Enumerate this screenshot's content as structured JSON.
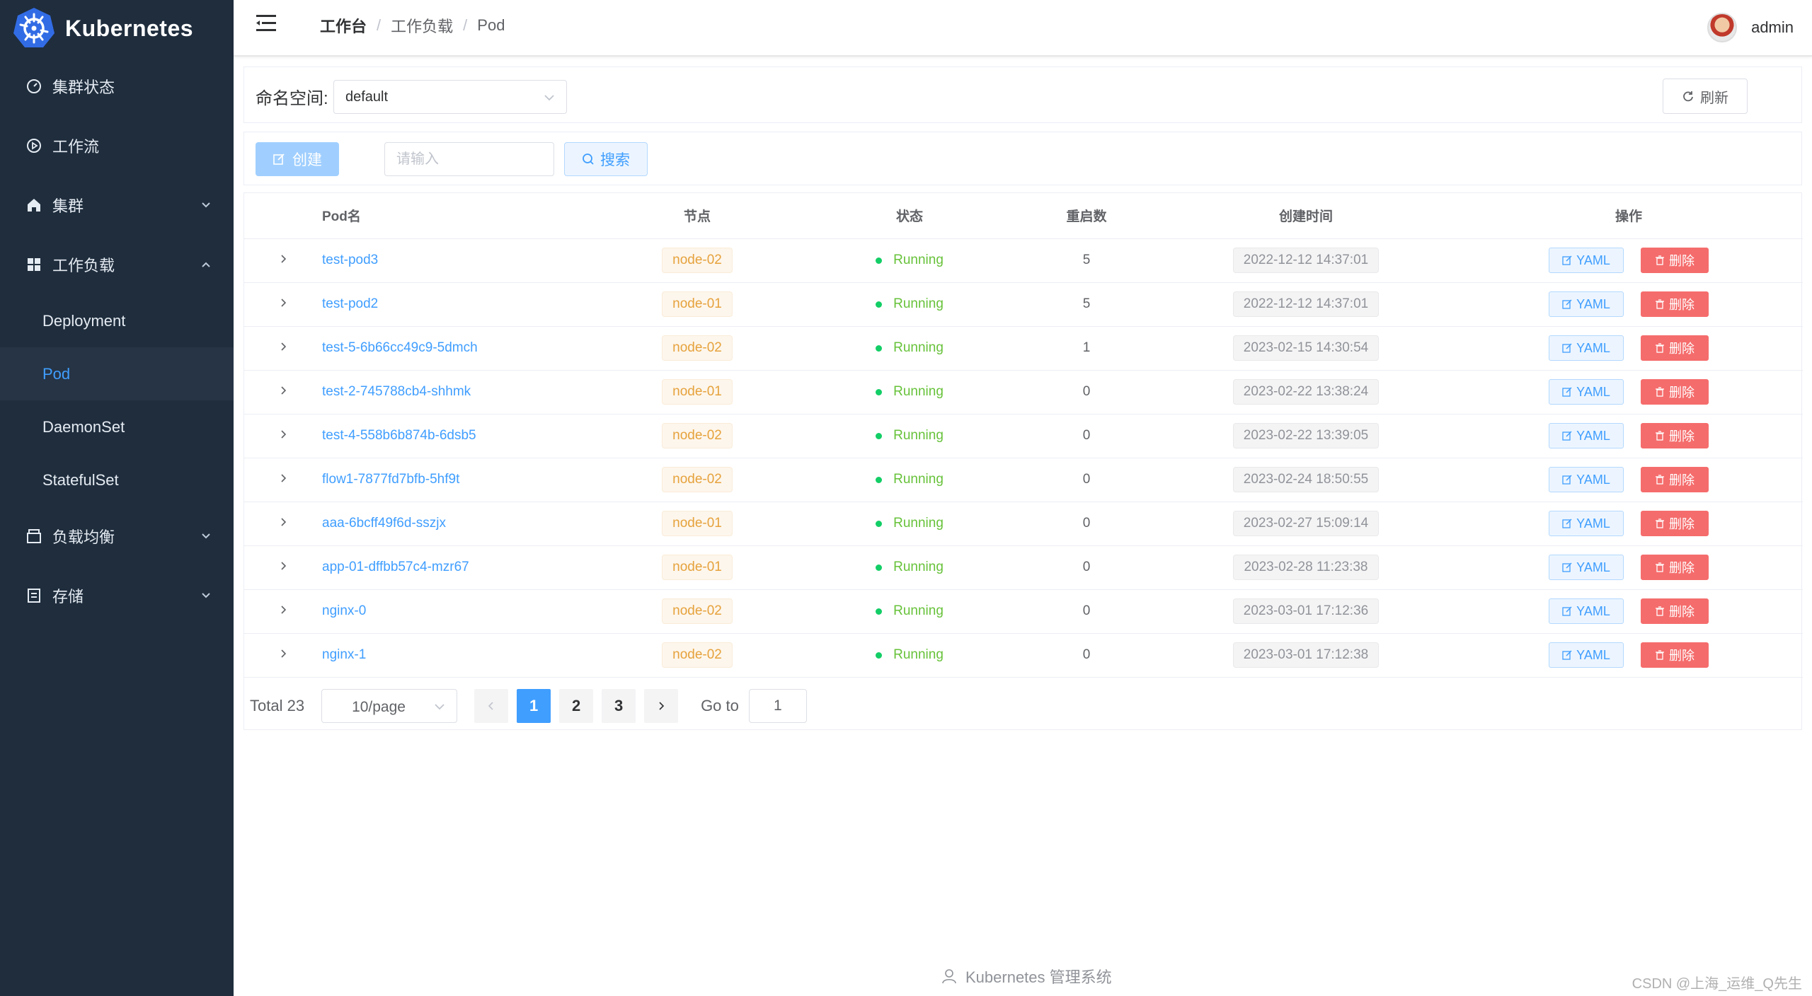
{
  "app": {
    "logo_text": "Kubernetes"
  },
  "sidebar": {
    "items": [
      {
        "label": "集群状态",
        "icon": "gauge-icon"
      },
      {
        "label": "工作流",
        "icon": "play-circle-icon"
      },
      {
        "label": "集群",
        "icon": "home-icon"
      },
      {
        "label": "工作负载",
        "icon": "grid-icon"
      }
    ],
    "sub_items": [
      {
        "label": "Deployment"
      },
      {
        "label": "Pod"
      },
      {
        "label": "DaemonSet"
      },
      {
        "label": "StatefulSet"
      }
    ],
    "bottom_items": [
      {
        "label": "负载均衡",
        "icon": "box-icon"
      },
      {
        "label": "存储",
        "icon": "document-icon"
      }
    ]
  },
  "header": {
    "breadcrumb": [
      "工作台",
      "工作负载",
      "Pod"
    ],
    "separator": "/",
    "username": "admin"
  },
  "namespace": {
    "label": "命名空间:",
    "value": "default",
    "refresh_label": "刷新"
  },
  "toolbar": {
    "create_label": "创建",
    "search_placeholder": "请输入",
    "search_label": "搜索"
  },
  "table": {
    "columns": [
      "Pod名",
      "节点",
      "状态",
      "重启数",
      "创建时间",
      "操作"
    ],
    "yaml_label": "YAML",
    "delete_label": "删除",
    "rows": [
      {
        "name": "test-pod3",
        "node": "node-02",
        "status": "Running",
        "restarts": "5",
        "created": "2022-12-12 14:37:01"
      },
      {
        "name": "test-pod2",
        "node": "node-01",
        "status": "Running",
        "restarts": "5",
        "created": "2022-12-12 14:37:01"
      },
      {
        "name": "test-5-6b66cc49c9-5dmch",
        "node": "node-02",
        "status": "Running",
        "restarts": "1",
        "created": "2023-02-15 14:30:54"
      },
      {
        "name": "test-2-745788cb4-shhmk",
        "node": "node-01",
        "status": "Running",
        "restarts": "0",
        "created": "2023-02-22 13:38:24"
      },
      {
        "name": "test-4-558b6b874b-6dsb5",
        "node": "node-02",
        "status": "Running",
        "restarts": "0",
        "created": "2023-02-22 13:39:05"
      },
      {
        "name": "flow1-7877fd7bfb-5hf9t",
        "node": "node-02",
        "status": "Running",
        "restarts": "0",
        "created": "2023-02-24 18:50:55"
      },
      {
        "name": "aaa-6bcff49f6d-sszjx",
        "node": "node-01",
        "status": "Running",
        "restarts": "0",
        "created": "2023-02-27 15:09:14"
      },
      {
        "name": "app-01-dffbb57c4-mzr67",
        "node": "node-01",
        "status": "Running",
        "restarts": "0",
        "created": "2023-02-28 11:23:38"
      },
      {
        "name": "nginx-0",
        "node": "node-02",
        "status": "Running",
        "restarts": "0",
        "created": "2023-03-01 17:12:36"
      },
      {
        "name": "nginx-1",
        "node": "node-02",
        "status": "Running",
        "restarts": "0",
        "created": "2023-03-01 17:12:38"
      }
    ]
  },
  "pagination": {
    "total": "Total 23",
    "page_size": "10/page",
    "pages": [
      "1",
      "2",
      "3"
    ],
    "current": "1",
    "goto_label": "Go to",
    "goto_value": "1"
  },
  "footer": {
    "text": "Kubernetes 管理系统"
  },
  "watermark": "CSDN @上海_运维_Q先生",
  "colors": {
    "sidebar_bg": "#1f2d3d",
    "primary": "#409eff",
    "danger": "#f56c6c",
    "success": "#67c23a",
    "warning": "#e6a23c"
  }
}
